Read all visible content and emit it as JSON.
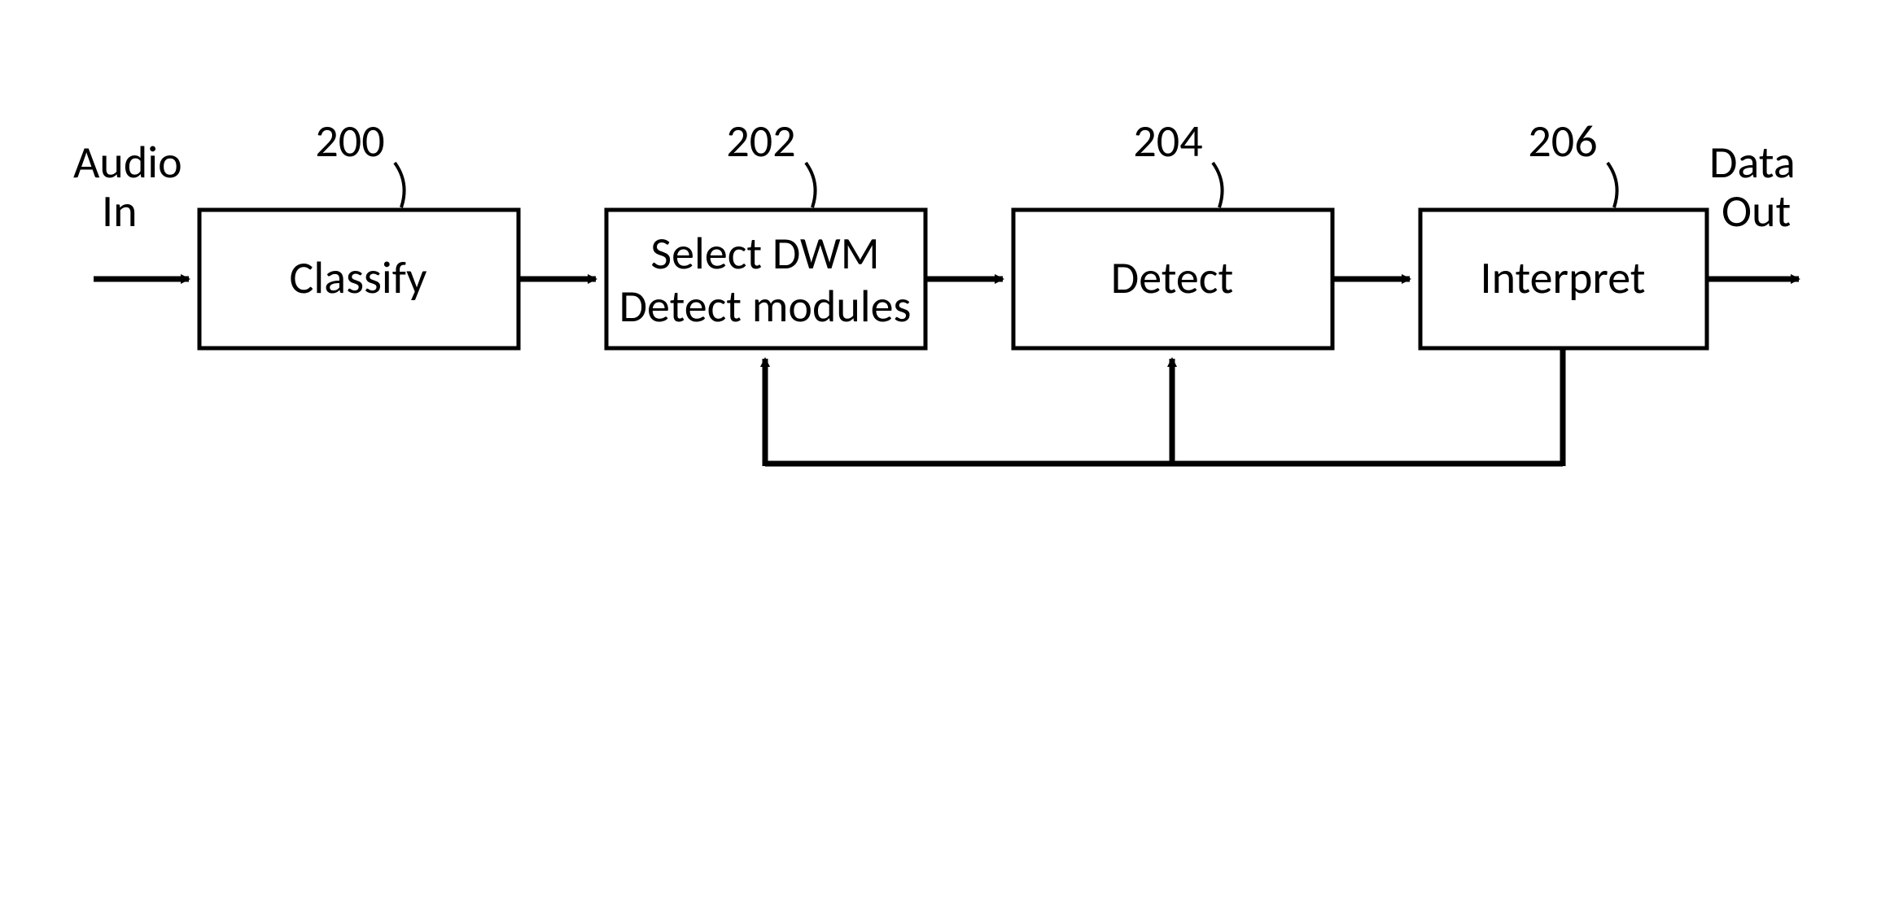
{
  "diagram": {
    "input_label_line1": "Audio",
    "input_label_line2": "In",
    "output_label_line1": "Data",
    "output_label_line2": "Out",
    "blocks": [
      {
        "id": "200",
        "label_lines": [
          "Classify"
        ]
      },
      {
        "id": "202",
        "label_lines": [
          "Select DWM",
          "Detect modules"
        ]
      },
      {
        "id": "204",
        "label_lines": [
          "Detect"
        ]
      },
      {
        "id": "206",
        "label_lines": [
          "Interpret"
        ]
      }
    ]
  }
}
